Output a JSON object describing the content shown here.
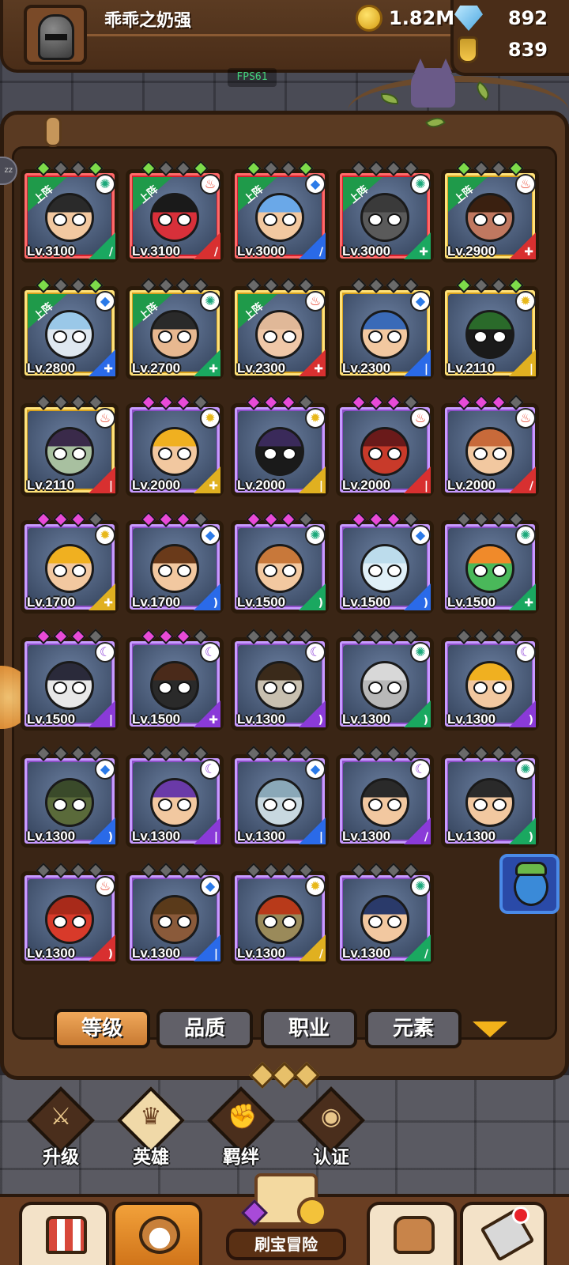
{
  "player": {
    "name": "乖乖之奶强"
  },
  "currency": {
    "gold": "1.82M",
    "gems": "892",
    "potions": "839"
  },
  "fps": "FPS61",
  "heroes": [
    {
      "level": "Lv.3100",
      "rarity": "red",
      "deployed": true,
      "element": "wind",
      "class": "sword",
      "class_color": "c-green",
      "stars": "green",
      "skin": "#f2c8a0",
      "hair": "#2a2a2a"
    },
    {
      "level": "Lv.3100",
      "rarity": "red",
      "deployed": true,
      "element": "fire",
      "class": "sword",
      "class_color": "c-red",
      "stars": "green",
      "skin": "#d8303a",
      "hair": "#1a1a1a"
    },
    {
      "level": "Lv.3000",
      "rarity": "red",
      "deployed": true,
      "element": "water",
      "class": "sword",
      "class_color": "c-blue",
      "stars": "green",
      "skin": "#f2c8a0",
      "hair": "#6aa8e8"
    },
    {
      "level": "Lv.3000",
      "rarity": "red",
      "deployed": true,
      "element": "wind",
      "class": "shield",
      "class_color": "c-green",
      "stars": "gray",
      "skin": "#5a5a5a",
      "hair": "#3a3a3a"
    },
    {
      "level": "Lv.2900",
      "rarity": "gold",
      "deployed": true,
      "element": "fire",
      "class": "shield",
      "class_color": "c-red",
      "stars": "green",
      "skin": "#c07860",
      "hair": "#3a2010"
    },
    {
      "level": "Lv.2800",
      "rarity": "gold",
      "deployed": true,
      "element": "water",
      "class": "shield",
      "class_color": "c-blue",
      "stars": "green",
      "skin": "#dfe8f0",
      "hair": "#9ac8e8"
    },
    {
      "level": "Lv.2700",
      "rarity": "gold",
      "deployed": true,
      "element": "wind",
      "class": "shield",
      "class_color": "c-green",
      "stars": "gray",
      "skin": "#e8b890",
      "hair": "#2a2a2a"
    },
    {
      "level": "Lv.2300",
      "rarity": "gold",
      "deployed": true,
      "element": "fire",
      "class": "shield",
      "class_color": "c-red",
      "stars": "gray",
      "skin": "#f0c8a8",
      "hair": "#e0b898"
    },
    {
      "level": "Lv.2300",
      "rarity": "gold",
      "deployed": false,
      "element": "water",
      "class": "staff",
      "class_color": "c-blue",
      "stars": "gray",
      "skin": "#f2c8a0",
      "hair": "#3a6ab8"
    },
    {
      "level": "Lv.2110",
      "rarity": "gold",
      "deployed": false,
      "element": "light",
      "class": "staff",
      "class_color": "c-gold",
      "stars": "green",
      "skin": "#1a1a1a",
      "hair": "#2a6a2a"
    },
    {
      "level": "Lv.2110",
      "rarity": "gold",
      "deployed": false,
      "element": "fire",
      "class": "staff",
      "class_color": "c-red",
      "stars": "gray",
      "skin": "#a8c0a0",
      "hair": "#3a2a4a"
    },
    {
      "level": "Lv.2000",
      "rarity": "purple",
      "deployed": false,
      "element": "light",
      "class": "shield",
      "class_color": "c-gold",
      "stars": "pink",
      "skin": "#f2c8a0",
      "hair": "#f0b020"
    },
    {
      "level": "Lv.2000",
      "rarity": "purple",
      "deployed": false,
      "element": "light",
      "class": "staff",
      "class_color": "c-gold",
      "stars": "pink",
      "skin": "#1a1a1a",
      "hair": "#3a2a5a"
    },
    {
      "level": "Lv.2000",
      "rarity": "purple",
      "deployed": false,
      "element": "fire",
      "class": "staff",
      "class_color": "c-red",
      "stars": "pink",
      "skin": "#c83a2a",
      "hair": "#6a1a1a"
    },
    {
      "level": "Lv.2000",
      "rarity": "purple",
      "deployed": false,
      "element": "fire",
      "class": "sword",
      "class_color": "c-red",
      "stars": "pink",
      "skin": "#f2c8a0",
      "hair": "#c86a3a"
    },
    {
      "level": "Lv.1700",
      "rarity": "purple",
      "deployed": false,
      "element": "light",
      "class": "shield",
      "class_color": "c-gold",
      "stars": "pink",
      "skin": "#f2c8a0",
      "hair": "#f0b020"
    },
    {
      "level": "Lv.1700",
      "rarity": "purple",
      "deployed": false,
      "element": "water",
      "class": "bow",
      "class_color": "c-blue",
      "stars": "pink",
      "skin": "#f2c8a0",
      "hair": "#6a3a1a"
    },
    {
      "level": "Lv.1500",
      "rarity": "purple",
      "deployed": false,
      "element": "wind",
      "class": "bow",
      "class_color": "c-green",
      "stars": "pink",
      "skin": "#f2c8a0",
      "hair": "#c8783a"
    },
    {
      "level": "Lv.1500",
      "rarity": "purple",
      "deployed": false,
      "element": "water",
      "class": "bow",
      "class_color": "c-blue",
      "stars": "pink",
      "skin": "#e0f0f8",
      "hair": "#bcdcec"
    },
    {
      "level": "Lv.1500",
      "rarity": "purple",
      "deployed": false,
      "element": "wind",
      "class": "shield",
      "class_color": "c-green",
      "stars": "gray",
      "skin": "#4ab85a",
      "hair": "#f08a2a"
    },
    {
      "level": "Lv.1500",
      "rarity": "purple",
      "deployed": false,
      "element": "dark",
      "class": "staff",
      "class_color": "c-purple",
      "stars": "pink",
      "skin": "#e8e8e8",
      "hair": "#2a2a3a"
    },
    {
      "level": "Lv.1500",
      "rarity": "purple",
      "deployed": false,
      "element": "dark",
      "class": "shield",
      "class_color": "c-purple",
      "stars": "pink",
      "skin": "#2a2a2a",
      "hair": "#4a2a1a"
    },
    {
      "level": "Lv.1300",
      "rarity": "purple",
      "deployed": false,
      "element": "dark",
      "class": "bow",
      "class_color": "c-purple",
      "stars": "gray",
      "skin": "#c8c0b0",
      "hair": "#3a2a1a"
    },
    {
      "level": "Lv.1300",
      "rarity": "purple",
      "deployed": false,
      "element": "wind",
      "class": "bow",
      "class_color": "c-green",
      "stars": "gray",
      "skin": "#b8b8b8",
      "hair": "#d8d8d8"
    },
    {
      "level": "Lv.1300",
      "rarity": "purple",
      "deployed": false,
      "element": "dark",
      "class": "bow",
      "class_color": "c-purple",
      "stars": "gray",
      "skin": "#f2c8a0",
      "hair": "#f0b020"
    },
    {
      "level": "Lv.1300",
      "rarity": "purple",
      "deployed": false,
      "element": "water",
      "class": "bow",
      "class_color": "c-blue",
      "stars": "gray",
      "skin": "#5a6a3a",
      "hair": "#3a4a2a"
    },
    {
      "level": "Lv.1300",
      "rarity": "purple",
      "deployed": false,
      "element": "dark",
      "class": "staff",
      "class_color": "c-purple",
      "stars": "gray",
      "skin": "#f2c8a0",
      "hair": "#6a3aa8"
    },
    {
      "level": "Lv.1300",
      "rarity": "purple",
      "deployed": false,
      "element": "water",
      "class": "staff",
      "class_color": "c-blue",
      "stars": "gray",
      "skin": "#c8d8e0",
      "hair": "#8aa8b8"
    },
    {
      "level": "Lv.1300",
      "rarity": "purple",
      "deployed": false,
      "element": "dark",
      "class": "sword",
      "class_color": "c-purple",
      "stars": "gray",
      "skin": "#f2c8a0",
      "hair": "#2a2a2a"
    },
    {
      "level": "Lv.1300",
      "rarity": "purple",
      "deployed": false,
      "element": "wind",
      "class": "bow",
      "class_color": "c-green",
      "stars": "gray",
      "skin": "#f2c8a0",
      "hair": "#2a2a2a"
    },
    {
      "level": "Lv.1300",
      "rarity": "purple",
      "deployed": false,
      "element": "fire",
      "class": "bow",
      "class_color": "c-red",
      "stars": "gray",
      "skin": "#d83a2a",
      "hair": "#a82a1a"
    },
    {
      "level": "Lv.1300",
      "rarity": "purple",
      "deployed": false,
      "element": "water",
      "class": "staff",
      "class_color": "c-blue",
      "stars": "gray",
      "skin": "#8a5a3a",
      "hair": "#5a3a1a"
    },
    {
      "level": "Lv.1300",
      "rarity": "purple",
      "deployed": false,
      "element": "light",
      "class": "sword",
      "class_color": "c-gold",
      "stars": "gray",
      "skin": "#9a8a5a",
      "hair": "#b83a1a"
    },
    {
      "level": "Lv.1300",
      "rarity": "purple",
      "deployed": false,
      "element": "wind",
      "class": "sword",
      "class_color": "c-green",
      "stars": "gray",
      "skin": "#f2c8a0",
      "hair": "#2a3a6a"
    }
  ],
  "deploy_label": "上阵",
  "sort_tabs": [
    "等级",
    "品质",
    "职业",
    "元素"
  ],
  "subnav": [
    {
      "label": "升级",
      "icon": "sword-upgrade-icon",
      "glyph": "⚔"
    },
    {
      "label": "英雄",
      "icon": "hero-icon",
      "glyph": "♛"
    },
    {
      "label": "羁绊",
      "icon": "bond-icon",
      "glyph": "✊"
    },
    {
      "label": "认证",
      "icon": "eye-icon",
      "glyph": "◉"
    }
  ],
  "bottom_nav": {
    "adventure_label": "刷宝冒险"
  }
}
